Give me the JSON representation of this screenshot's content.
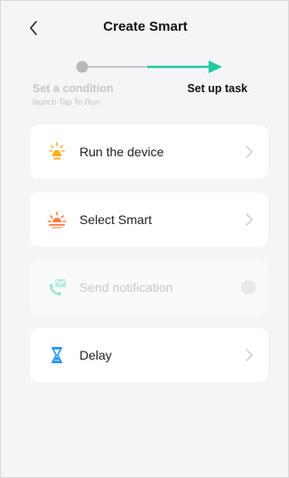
{
  "header": {
    "title": "Create Smart"
  },
  "steps": {
    "left_title": "Set a condition",
    "left_subtitle": "launch Tap To Run",
    "right_title": "Set up task"
  },
  "tasks": [
    {
      "label": "Run the device",
      "icon": "bulb-icon",
      "enabled": true
    },
    {
      "label": "Select Smart",
      "icon": "sunrise-icon",
      "enabled": true
    },
    {
      "label": "Send notification",
      "icon": "notification-phone-icon",
      "enabled": false
    },
    {
      "label": "Delay",
      "icon": "hourglass-icon",
      "enabled": true
    }
  ],
  "colors": {
    "accent": "#1ec9a4",
    "bulb": "#ffb020",
    "sunrise": "#ff7a3d",
    "notification": "#9ee6d2",
    "hourglass": "#2196f3"
  }
}
